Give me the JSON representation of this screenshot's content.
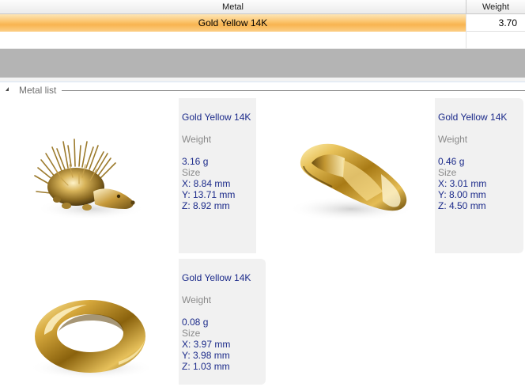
{
  "table": {
    "headers": {
      "metal": "Metal",
      "weight": "Weight"
    },
    "rows": [
      {
        "metal": "Gold Yellow 14K",
        "weight": "3.70"
      }
    ]
  },
  "metal_list": {
    "title": "Metal list",
    "items": [
      {
        "name": "Gold Yellow 14K",
        "weight_label": "Weight",
        "weight": "3.16 g",
        "size_label": "Size",
        "x": "X: 8.84 mm",
        "y": "Y: 13.71 mm",
        "z": "Z: 8.92 mm",
        "thumbnail": "hedgehog-model"
      },
      {
        "name": "Gold Yellow 14K",
        "weight_label": "Weight",
        "weight": "0.46 g",
        "size_label": "Size",
        "x": "X: 3.01 mm",
        "y": "Y: 8.00 mm",
        "z": "Z: 4.50 mm",
        "thumbnail": "gold-nugget-model"
      },
      {
        "name": "Gold Yellow 14K",
        "weight_label": "Weight",
        "weight": "0.08 g",
        "size_label": "Size",
        "x": "X: 3.97 mm",
        "y": "Y: 3.98 mm",
        "z": "Z: 1.03 mm",
        "thumbnail": "gold-ring-model"
      }
    ]
  },
  "colors": {
    "selection_gold": "#fbc268",
    "info_text": "#1b2a8a",
    "label_gray": "#8a8a8a",
    "band_gray": "#b4b4b4"
  }
}
